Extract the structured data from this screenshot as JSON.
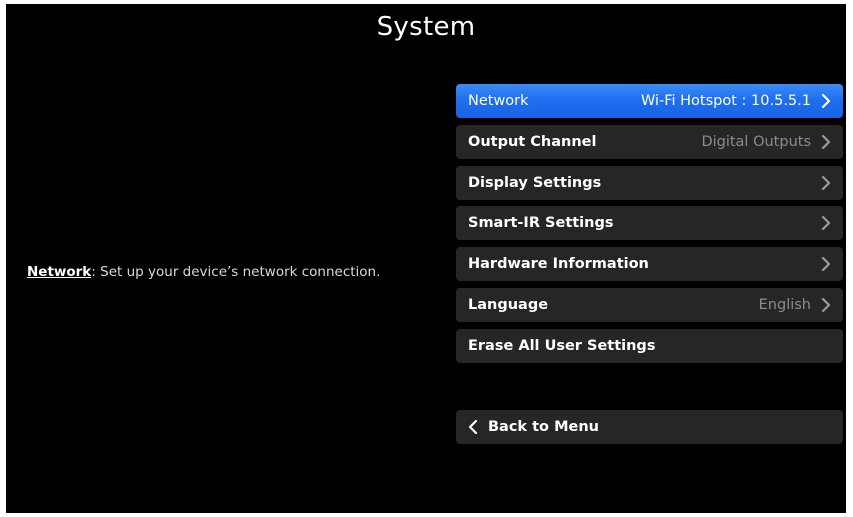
{
  "screen": {
    "title": "System",
    "background": "#000000"
  },
  "description": {
    "key": "Network",
    "text": ": Set up your device’s network connection."
  },
  "menu": {
    "selected_color": "#1f6ff0",
    "items": [
      {
        "label": "Network",
        "value": "Wi-Fi Hotspot : 10.5.5.1",
        "icon": "chevron-right-icon"
      },
      {
        "label": "Output Channel",
        "value": "Digital Outputs",
        "icon": "chevron-right-icon"
      },
      {
        "label": "Display Settings",
        "value": "",
        "icon": "chevron-right-icon"
      },
      {
        "label": "Smart-IR Settings",
        "value": "",
        "icon": "chevron-right-icon"
      },
      {
        "label": "Hardware Information",
        "value": "",
        "icon": "chevron-right-icon"
      },
      {
        "label": "Language",
        "value": "English",
        "icon": "chevron-right-icon"
      },
      {
        "label": "Erase All User Settings",
        "value": ""
      }
    ]
  },
  "back": {
    "label": "Back to Menu",
    "icon": "chevron-left-icon"
  }
}
